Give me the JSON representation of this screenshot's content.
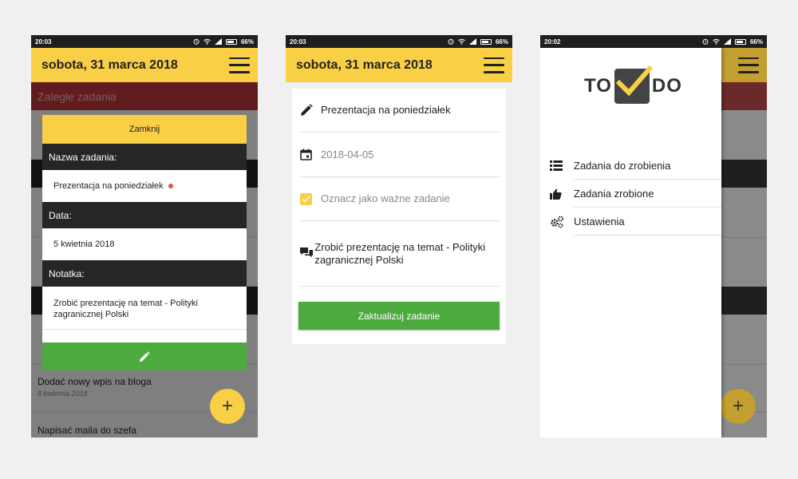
{
  "status": {
    "phone1_time": "20:03",
    "phone2_time": "20:03",
    "phone3_time": "20:02",
    "battery": "66%"
  },
  "header": {
    "date_title": "sobota, 31 marca 2018"
  },
  "phone1": {
    "section_overdue": "Zaległe zadania",
    "tasks": [
      {
        "title": "Dodać nowy wpis na bloga",
        "date": "8 kwietnia 2018"
      },
      {
        "title": "Napisać maila do szefa",
        "date": ""
      }
    ],
    "dialog": {
      "close_label": "Zamknij",
      "name_label": "Nazwa zadania:",
      "name_value": "Prezentacja na poniedziałek",
      "date_label": "Data:",
      "date_value": "5 kwietnia 2018",
      "note_label": "Notatka:",
      "note_value": "Zrobić prezentację na temat - Polityki zagranicznej Polski"
    },
    "fab_label": "+"
  },
  "phone2": {
    "task_name": "Prezentacja na poniedziałek",
    "task_date": "2018-04-05",
    "important_label": "Oznacz jako ważne zadanie",
    "important_checked": true,
    "note": "Zrobić prezentację na temat - Polityki zagranicznej Polski",
    "update_button": "Zaktualizuj zadanie"
  },
  "phone3": {
    "logo_left": "TO",
    "logo_right": "DO",
    "menu": [
      {
        "label": "Zadania do zrobienia",
        "icon": "list-icon"
      },
      {
        "label": "Zadania zrobione",
        "icon": "thumbs-up-icon"
      },
      {
        "label": "Ustawienia",
        "icon": "gears-icon"
      }
    ],
    "fab_label": "+"
  },
  "colors": {
    "accent_yellow": "#f9cf45",
    "action_green": "#4daa3f",
    "overdue_red": "#c23a3a",
    "dark": "#262626"
  }
}
